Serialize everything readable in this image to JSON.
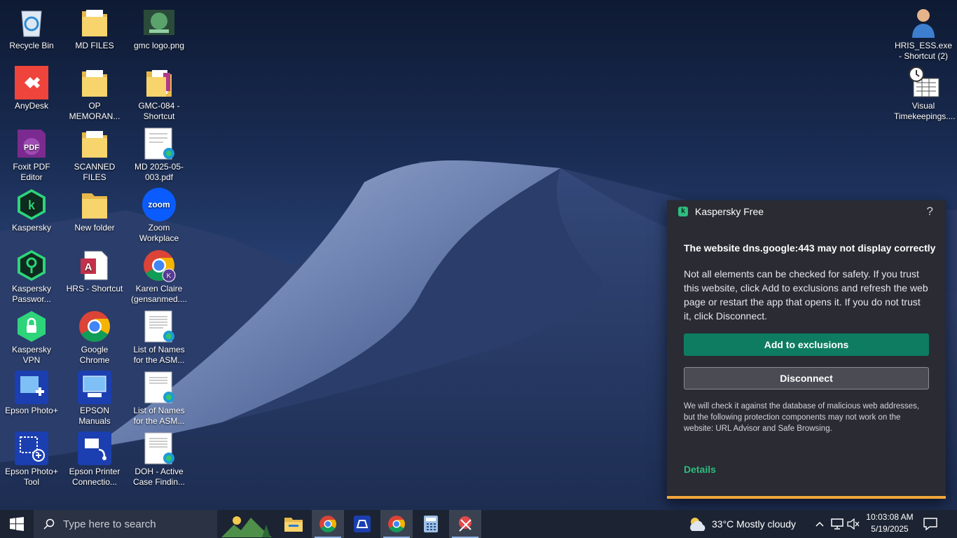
{
  "desktop": {
    "icons": [
      {
        "label": "Recycle Bin"
      },
      {
        "label": "MD FILES"
      },
      {
        "label": "gmc logo.png"
      },
      {
        "label": "AnyDesk"
      },
      {
        "label": "OP MEMORAN..."
      },
      {
        "label": "GMC-084 - Shortcut"
      },
      {
        "label": "Foxit PDF Editor"
      },
      {
        "label": "SCANNED FILES"
      },
      {
        "label": "MD 2025-05-003.pdf"
      },
      {
        "label": "Kaspersky"
      },
      {
        "label": "New folder"
      },
      {
        "label": "Zoom Workplace"
      },
      {
        "label": "Kaspersky Passwor..."
      },
      {
        "label": "HRS - Shortcut"
      },
      {
        "label": "Karen Claire (gensanmed...."
      },
      {
        "label": "Kaspersky VPN"
      },
      {
        "label": "Google Chrome"
      },
      {
        "label": "List of Names for the ASM..."
      },
      {
        "label": "Epson Photo+"
      },
      {
        "label": "EPSON Manuals"
      },
      {
        "label": "List of Names for the ASM..."
      },
      {
        "label": "Epson Photo+ Tool"
      },
      {
        "label": "Epson Printer Connectio..."
      },
      {
        "label": "DOH - Active Case Findin..."
      },
      {
        "label": "HRIS_ESS.exe - Shortcut (2)"
      },
      {
        "label": "Visual Timekeepings...."
      }
    ]
  },
  "kaspersky": {
    "app_name": "Kaspersky Free",
    "help": "?",
    "title": "The website dns.google:443 may not display correctly",
    "body": "Not all elements can be checked for safety. If you trust this website, click Add to exclusions and refresh the web page or restart the app that opens it. If you do not trust it, click Disconnect.",
    "add_button": "Add to exclusions",
    "disconnect_button": "Disconnect",
    "note": "We will check it against the database of malicious web addresses, but the following protection components may not work on the website: URL Advisor and Safe Browsing.",
    "details_link": "Details",
    "accent_color": "#2dbd7e"
  },
  "taskbar": {
    "search_placeholder": "Type here to search",
    "weather": "33°C  Mostly cloudy",
    "time": "10:03:08 AM",
    "date": "5/19/2025"
  }
}
